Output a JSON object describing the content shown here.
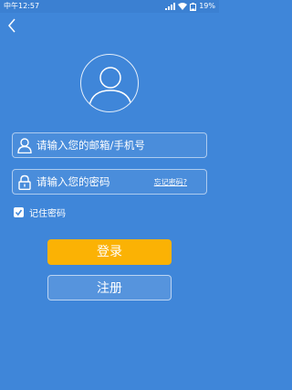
{
  "status_bar": {
    "time": "中午12:57",
    "battery": "19%"
  },
  "login": {
    "username_placeholder": "请输入您的邮箱/手机号",
    "password_placeholder": "请输入您的密码",
    "forgot_password": "忘记密码?",
    "remember_label": "记住密码",
    "remember_checked": true,
    "login_label": "登录",
    "register_label": "注册"
  },
  "colors": {
    "background": "#3f86d9",
    "login_button": "#fbb204"
  },
  "icons": [
    "back-icon",
    "avatar-icon",
    "user-icon",
    "lock-icon",
    "check-icon",
    "signal-icon",
    "wifi-icon",
    "battery-icon"
  ]
}
